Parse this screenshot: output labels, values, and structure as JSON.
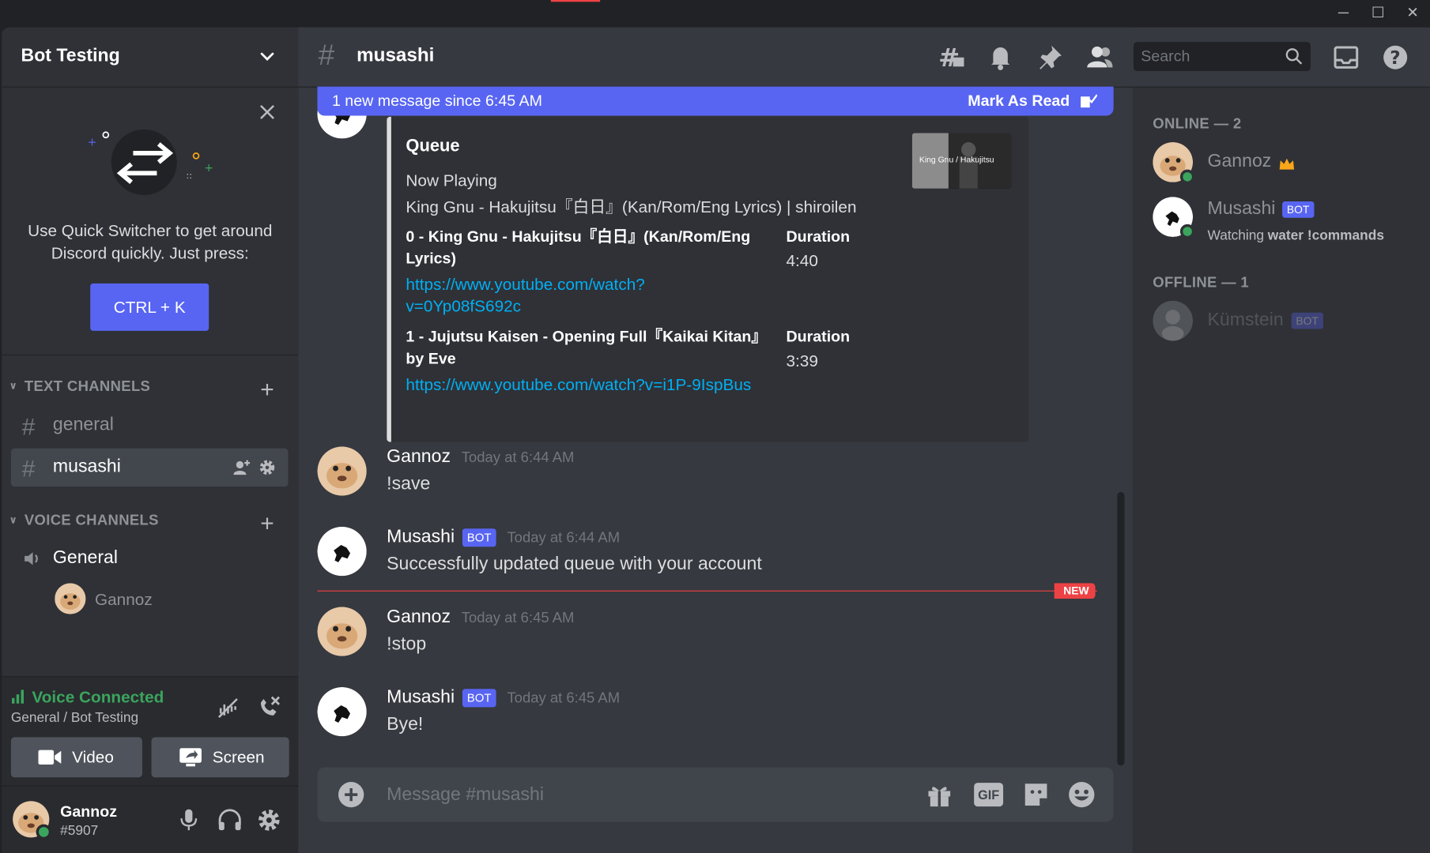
{
  "window": {
    "minimize": "─",
    "maximize": "☐",
    "close": "✕"
  },
  "server": {
    "name": "Bot Testing"
  },
  "quick_switcher": {
    "text": "Use Quick Switcher to get around Discord quickly. Just press:",
    "shortcut": "CTRL + K"
  },
  "sidebar": {
    "text_category": "TEXT CHANNELS",
    "voice_category": "VOICE CHANNELS",
    "text_channels": [
      "general",
      "musashi"
    ],
    "voice_channel": "General",
    "voice_user": "Gannoz"
  },
  "voice_panel": {
    "status": "Voice Connected",
    "location": "General / Bot Testing",
    "video_label": "Video",
    "screen_label": "Screen"
  },
  "user": {
    "name": "Gannoz",
    "tag": "#5907"
  },
  "header": {
    "channel": "musashi",
    "search_placeholder": "Search"
  },
  "new_messages_bar": {
    "text": "1 new message since 6:45 AM",
    "action": "Mark As Read"
  },
  "embed": {
    "title": "Queue",
    "now_playing_label": "Now Playing",
    "now_playing": "King Gnu - Hakujitsu『白日』(Kan/Rom/Eng Lyrics) | shiroilen",
    "thumb_caption": "King Gnu / Hakujitsu",
    "items": [
      {
        "title_line1": "0 - King Gnu - Hakujitsu『白日』(Kan/Rom/Eng",
        "title_line2": "Lyrics)",
        "duration_label": "Duration",
        "duration": "4:40",
        "url_line1": "https://www.youtube.com/watch?",
        "url_line2": "v=0Yp08fS692c"
      },
      {
        "title_line1": "1 - Jujutsu Kaisen - Opening Full『Kaikai Kitan』",
        "title_line2": "by Eve",
        "duration_label": "Duration",
        "duration": "3:39",
        "url_line1": "https://www.youtube.com/watch?v=i1P-9IspBus",
        "url_line2": ""
      }
    ]
  },
  "messages": [
    {
      "author": "Gannoz",
      "timestamp": "Today at 6:44 AM",
      "text": "!save",
      "bot": false
    },
    {
      "author": "Musashi",
      "timestamp": "Today at 6:44 AM",
      "text": "Successfully updated queue with your account",
      "bot": true,
      "badge": "BOT"
    },
    {
      "author": "Gannoz",
      "timestamp": "Today at 6:45 AM",
      "text": "!stop",
      "bot": false
    },
    {
      "author": "Musashi",
      "timestamp": "Today at 6:45 AM",
      "text": "Bye!",
      "bot": true,
      "badge": "BOT"
    }
  ],
  "new_divider_label": "NEW",
  "composer": {
    "placeholder": "Message #musashi",
    "gif_label": "GIF"
  },
  "members": {
    "online_header": "ONLINE — 2",
    "offline_header": "OFFLINE — 1",
    "online": [
      {
        "name": "Gannoz",
        "owner": true
      },
      {
        "name": "Musashi",
        "badge": "BOT",
        "activity_prefix": "Watching ",
        "activity": "water !commands"
      }
    ],
    "offline": [
      {
        "name": "Kümstein",
        "badge": "BOT"
      }
    ]
  },
  "colors": {
    "blurple": "#5865f2",
    "green": "#3ba55d",
    "red": "#ed4245",
    "link": "#00aff4"
  }
}
